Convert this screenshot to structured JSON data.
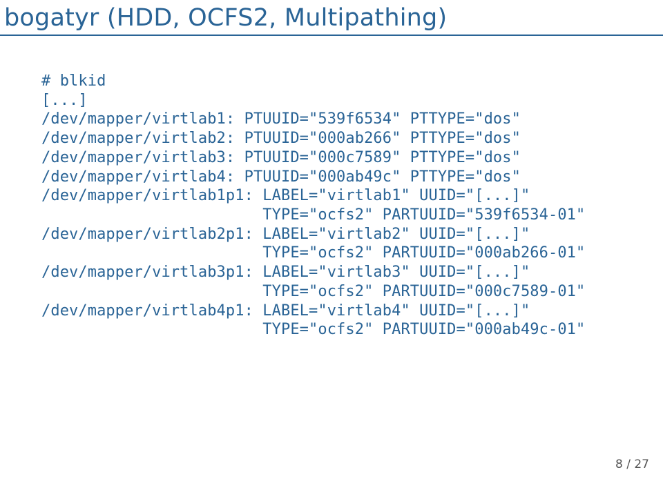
{
  "title": "bogatyr (HDD, OCFS2, Multipathing)",
  "cmd": "# blkid",
  "ell": "[...]",
  "lines": {
    "l1": "/dev/mapper/virtlab1: PTUUID=\"539f6534\" PTTYPE=\"dos\"",
    "l2": "/dev/mapper/virtlab2: PTUUID=\"000ab266\" PTTYPE=\"dos\"",
    "l3": "/dev/mapper/virtlab3: PTUUID=\"000c7589\" PTTYPE=\"dos\"",
    "l4": "/dev/mapper/virtlab4: PTUUID=\"000ab49c\" PTTYPE=\"dos\"",
    "l5": "/dev/mapper/virtlab1p1: LABEL=\"virtlab1\" UUID=\"[...]\"",
    "l6": "                        TYPE=\"ocfs2\" PARTUUID=\"539f6534-01\"",
    "l7": "/dev/mapper/virtlab2p1: LABEL=\"virtlab2\" UUID=\"[...]\"",
    "l8": "                        TYPE=\"ocfs2\" PARTUUID=\"000ab266-01\"",
    "l9": "/dev/mapper/virtlab3p1: LABEL=\"virtlab3\" UUID=\"[...]\"",
    "l10": "                        TYPE=\"ocfs2\" PARTUUID=\"000c7589-01\"",
    "l11": "/dev/mapper/virtlab4p1: LABEL=\"virtlab4\" UUID=\"[...]\"",
    "l12": "                        TYPE=\"ocfs2\" PARTUUID=\"000ab49c-01\""
  },
  "page": "8 / 27"
}
